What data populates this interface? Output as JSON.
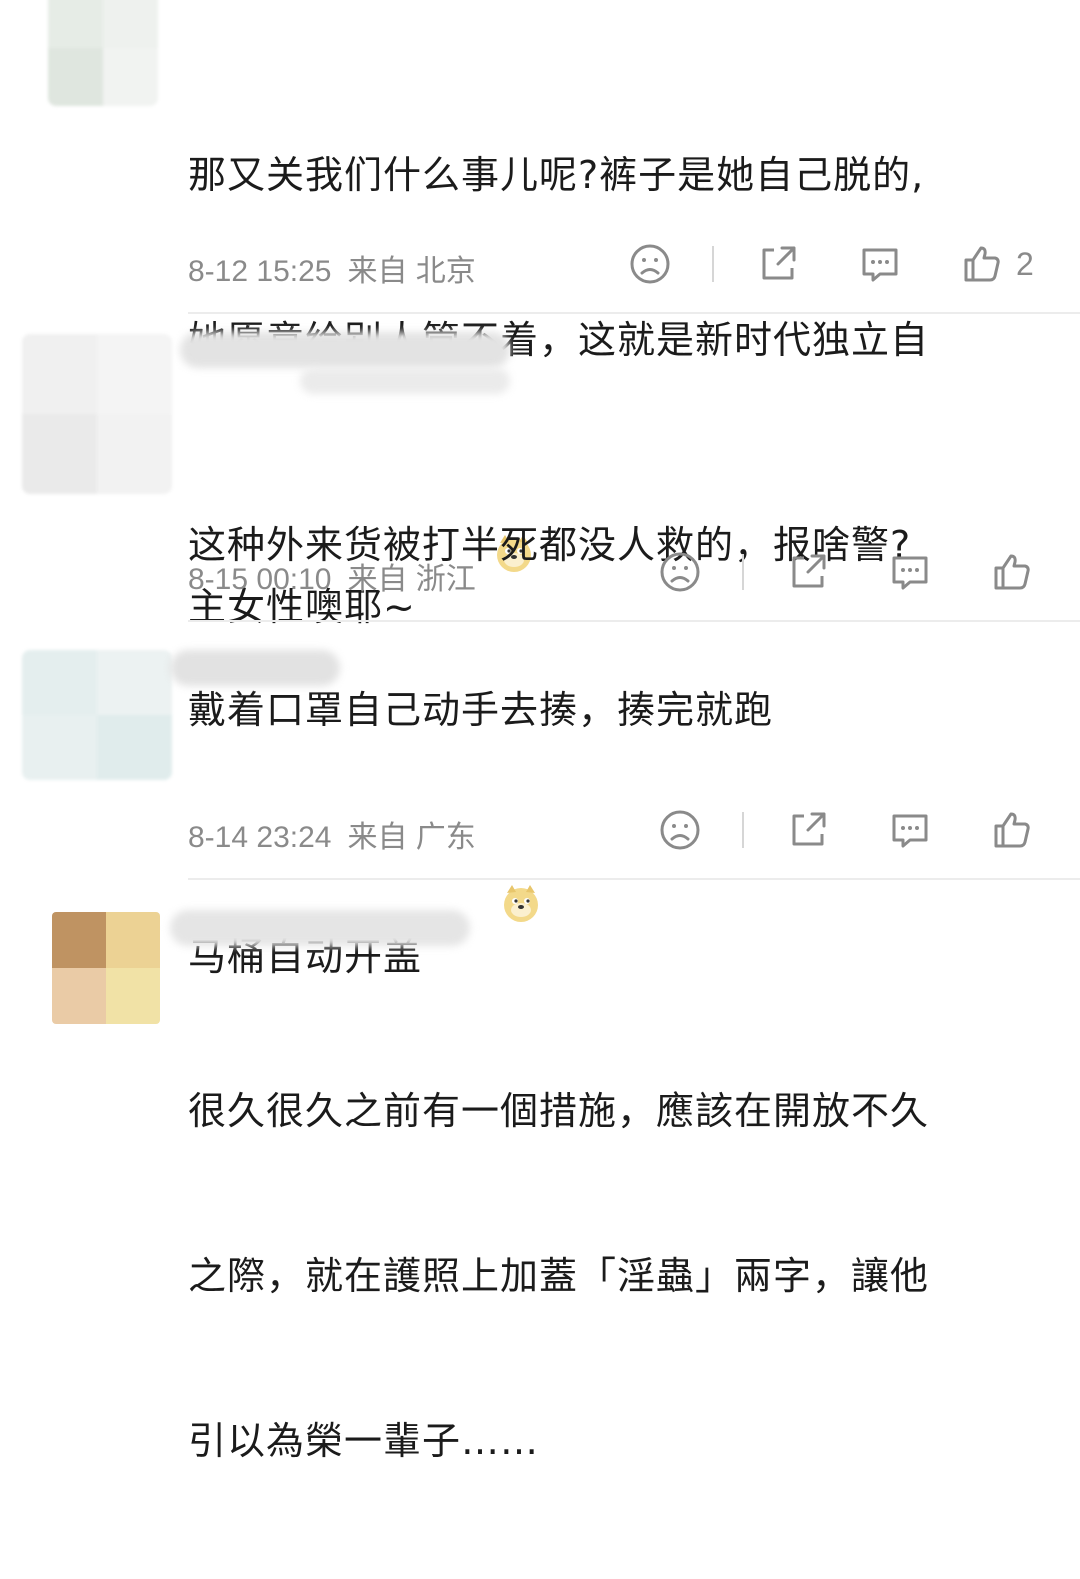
{
  "comments": [
    {
      "text_lines": [
        "那又关我们什么事儿呢?裤子是她自己脱的,",
        "她愿意给别人管不着，这就是新时代独立自",
        "主女性噢耶~"
      ],
      "time": "8-12 15:25",
      "location": "来自 北京",
      "likes": "2"
    },
    {
      "text_lines": [
        "这种外来货被打半死都没人救的，报啥警?",
        "戴着口罩自己动手去揍，揍完就跑"
      ],
      "time": "8-15 00:10",
      "location": "来自 浙江",
      "likes": ""
    },
    {
      "text_lines": [
        "马桶自动开盖"
      ],
      "time": "8-14 23:24",
      "location": "来自 广东",
      "likes": ""
    },
    {
      "text_lines": [
        "很久很久之前有一個措施，應該在開放不久",
        "之際，就在護照上加蓋「淫蟲」兩字，讓他",
        "引以為榮一輩子……"
      ],
      "time": "",
      "location": "",
      "likes": ""
    }
  ],
  "icons": {
    "dislike": "sad-face-icon",
    "share": "share-icon",
    "reply": "comment-bubble-icon",
    "like": "thumbs-up-icon",
    "emoji": "doge-emoji-icon"
  }
}
